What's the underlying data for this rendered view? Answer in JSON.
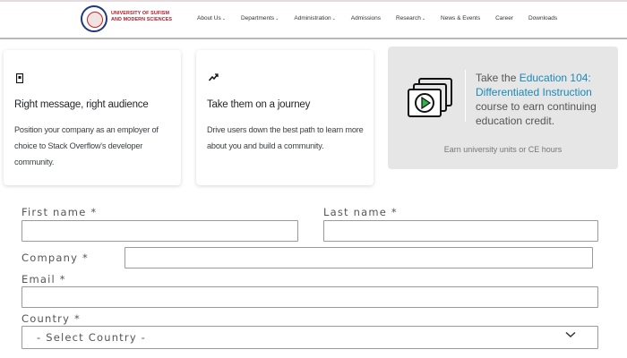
{
  "header": {
    "logo_line1": "UNIVERSITY OF SUFISM",
    "logo_line2": "AND MODERN SCIENCES",
    "nav": [
      {
        "label": "About Us",
        "dropdown": true
      },
      {
        "label": "Departments",
        "dropdown": true
      },
      {
        "label": "Administration",
        "dropdown": true
      },
      {
        "label": "Admissions",
        "dropdown": false
      },
      {
        "label": "Research",
        "dropdown": true
      },
      {
        "label": "News & Events",
        "dropdown": false
      },
      {
        "label": "Career",
        "dropdown": false
      },
      {
        "label": "Downloads",
        "dropdown": false
      }
    ]
  },
  "cards": [
    {
      "icon": "megaphone-icon",
      "title": "Right message, right audience",
      "body": "Position your company as an employer of choice to Stack Overflow's developer community."
    },
    {
      "icon": "trend-icon",
      "title": "Take them on a journey",
      "body": "Drive users down the best path to learn more about you and build a community."
    }
  ],
  "promo": {
    "text_before": "Take the ",
    "link": "Education 104: Differentiated Instruction",
    "text_after": " course to earn continuing education credit.",
    "footer": "Earn university units or CE hours"
  },
  "form": {
    "first_name_label": "First name *",
    "last_name_label": "Last name *",
    "company_label": "Company *",
    "email_label": "Email *",
    "country_label": "Country *",
    "country_value": "- Select Country -"
  },
  "colors": {
    "brand": "#b0182a",
    "link": "#1a8ab8",
    "promo_bg": "#e6e6e6"
  }
}
